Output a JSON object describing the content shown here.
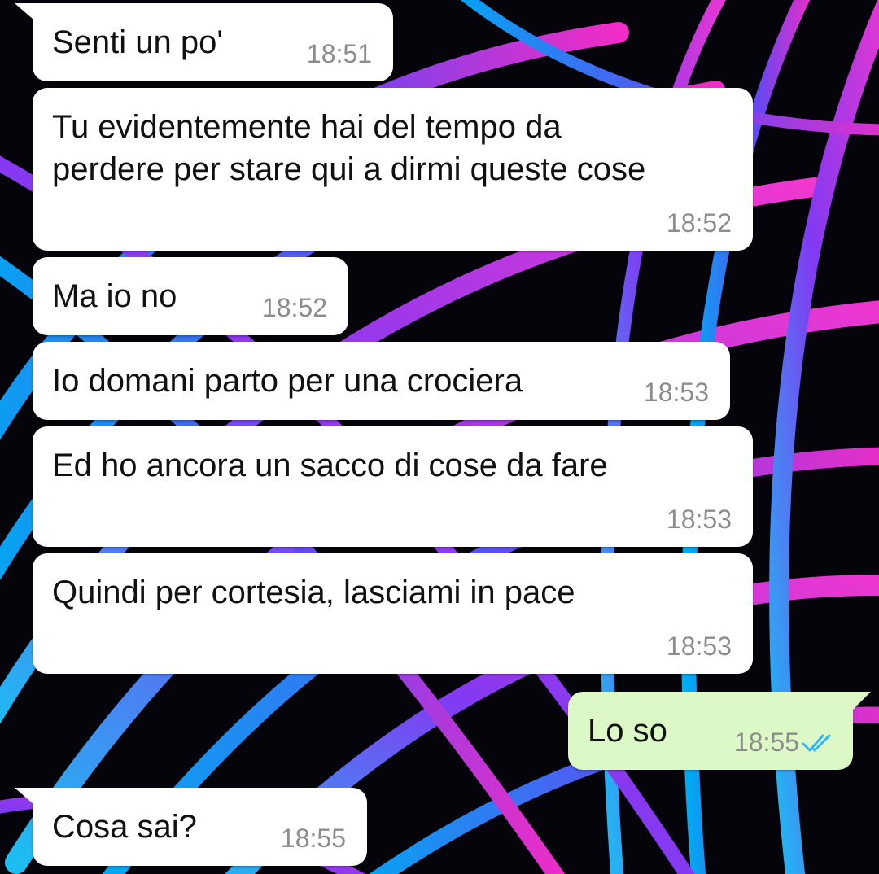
{
  "theme": {
    "incoming_bubble": "#ffffff",
    "outgoing_bubble": "#dcf8c6",
    "timestamp": "#8c8c8c",
    "read_tick": "#34b7f1",
    "wallpaper_colors": [
      "#00b4ff",
      "#7a3cff",
      "#ff2fd0",
      "#05040a"
    ]
  },
  "messages": [
    {
      "direction": "in",
      "text": "Senti un po'",
      "time": "18:51",
      "tail": true
    },
    {
      "direction": "in",
      "text": "Tu evidentemente hai del tempo da\nperdere per stare qui a dirmi queste cose",
      "time": "18:52"
    },
    {
      "direction": "in",
      "text": "Ma io no",
      "time": "18:52"
    },
    {
      "direction": "in",
      "text": "Io domani parto per una crociera",
      "time": "18:53"
    },
    {
      "direction": "in",
      "text": "Ed ho ancora un sacco di cose da fare",
      "time": "18:53"
    },
    {
      "direction": "in",
      "text": "Quindi per cortesia, lasciami in pace",
      "time": "18:53"
    },
    {
      "direction": "out",
      "text": "Lo so",
      "time": "18:55",
      "status": "read",
      "status_icon": "double-check-icon",
      "tail": true
    },
    {
      "direction": "in",
      "text": "Cosa sai?",
      "time": "18:55",
      "tail": true
    }
  ]
}
